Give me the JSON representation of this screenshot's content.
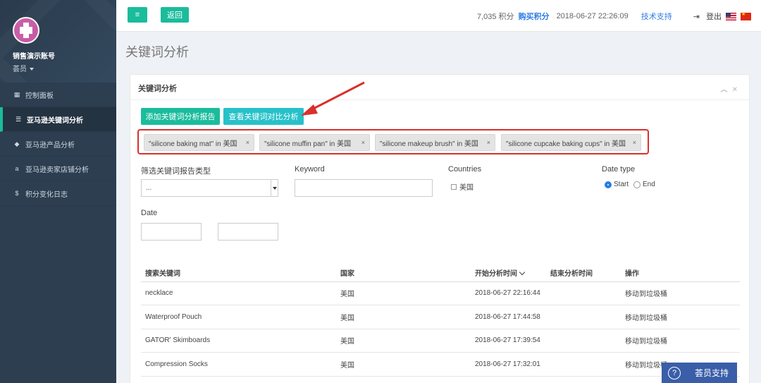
{
  "sidebar": {
    "account_name": "销售演示账号",
    "role": "荟员",
    "items": [
      {
        "label": "控制面板",
        "icon": "dashboard-icon"
      },
      {
        "label": "亚马逊关键词分析",
        "icon": "list-icon",
        "active": true
      },
      {
        "label": "亚马逊产品分析",
        "icon": "tag-icon"
      },
      {
        "label": "亚马逊卖家店铺分析",
        "icon": "amazon-icon"
      },
      {
        "label": "积分变化日志",
        "icon": "dollar-icon"
      }
    ]
  },
  "topbar": {
    "back_label": "返回",
    "points": "7,035 积分",
    "buy_points": "购买积分",
    "datetime": "2018-06-27 22:26:09",
    "support": "技术支持",
    "logout": "登出"
  },
  "page_title": "关键词分析",
  "panel": {
    "title": "关键词分析",
    "add_report": "添加关键词分析报告",
    "compare": "查看关键词对比分析",
    "tags": [
      "\"silicone baking mat\" in 美国",
      "\"silicone muffin pan\" in 美国",
      "\"silicone makeup brush\" in 美国",
      "\"silicone cupcake baking cups\" in 美国"
    ],
    "tag_close": "×",
    "filters": {
      "report_type_label": "筛选关键词报告类型",
      "report_type_value": "...",
      "keyword_label": "Keyword",
      "countries_label": "Countries",
      "country_option": "美国",
      "date_type_label": "Date type",
      "date_start": "Start",
      "date_end": "End",
      "date_label": "Date"
    }
  },
  "table": {
    "headers": [
      "搜索关键词",
      "国家",
      "开始分析时间",
      "结束分析时间",
      "操作"
    ],
    "rows": [
      [
        "necklace",
        "美国",
        "2018-06-27 22:16:44",
        "",
        "移动到垃圾桶"
      ],
      [
        "Waterproof Pouch",
        "美国",
        "2018-06-27 17:44:58",
        "",
        "移动到垃圾桶"
      ],
      [
        "GATOR' Skimboards",
        "美国",
        "2018-06-27 17:39:54",
        "",
        "移动到垃圾桶"
      ],
      [
        "Compression Socks",
        "美国",
        "2018-06-27 17:32:01",
        "",
        "移动到垃圾桶"
      ]
    ]
  },
  "chat": {
    "label": "荟员支持"
  },
  "colors": {
    "accent": "#1abc9c",
    "sidebar": "#2c3e50",
    "highlight": "#d9302b",
    "chat": "#3a5ea8"
  }
}
